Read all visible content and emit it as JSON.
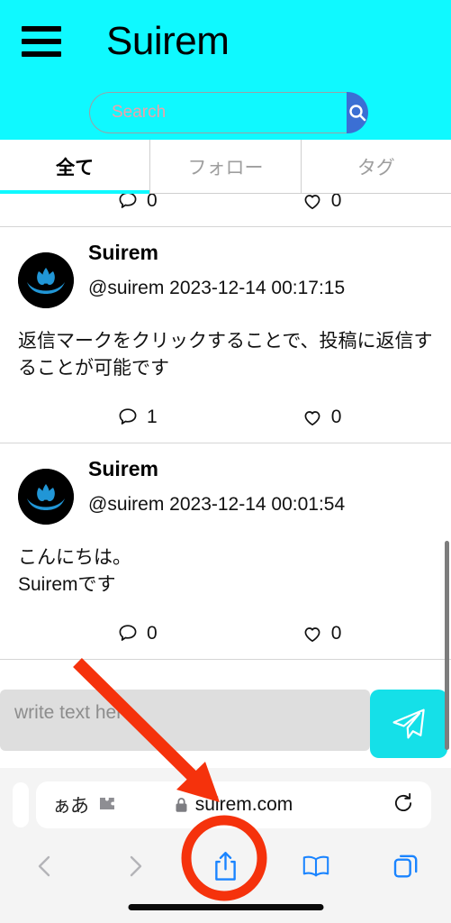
{
  "app": {
    "title": "Suirem",
    "menu_icon": "hamburger-menu-icon",
    "search": {
      "placeholder": "Search",
      "value": "",
      "button_icon": "search-icon",
      "button_color": "#3b6fd4"
    },
    "header_color": "#0ff9ff",
    "tabs": [
      {
        "label": "全て",
        "active": true
      },
      {
        "label": "フォロー",
        "active": false
      },
      {
        "label": "タグ",
        "active": false
      }
    ]
  },
  "feed": {
    "posts": [
      {
        "partial": true,
        "display_name": "",
        "handle": "",
        "timestamp": "",
        "body": "",
        "reply_count": "0",
        "like_count": "0"
      },
      {
        "partial": false,
        "display_name": "Suirem",
        "handle": "@suirem",
        "timestamp": "2023-12-14 00:17:15",
        "body": "返信マークをクリックすることで、投稿に返信することが可能です",
        "reply_count": "1",
        "like_count": "0"
      },
      {
        "partial": false,
        "display_name": "Suirem",
        "handle": "@suirem",
        "timestamp": "2023-12-14 00:01:54",
        "body": "こんにちは。\nSuiremです",
        "reply_count": "0",
        "like_count": "0"
      }
    ],
    "reply_icon": "speech-bubble-icon",
    "like_icon": "heart-icon",
    "avatar_icon": "lotus-flower-avatar"
  },
  "composer": {
    "placeholder": "write text here",
    "value": "",
    "send_icon": "paper-plane-send-icon",
    "send_color": "#15e0e8"
  },
  "browser": {
    "text_size_label": "ぁあ",
    "extensions_icon": "puzzle-piece-icon",
    "lock_icon": "lock-icon",
    "url": "suirem.com",
    "reload_icon": "reload-icon",
    "toolbar": [
      {
        "name": "back-button",
        "icon": "chevron-left-icon",
        "enabled": false
      },
      {
        "name": "forward-button",
        "icon": "chevron-right-icon",
        "enabled": false
      },
      {
        "name": "share-button",
        "icon": "share-up-arrow-icon",
        "enabled": true,
        "highlighted": true
      },
      {
        "name": "bookmarks-button",
        "icon": "open-book-icon",
        "enabled": true
      },
      {
        "name": "tabs-button",
        "icon": "copy-tabs-icon",
        "enabled": true
      }
    ]
  },
  "annotation": {
    "color": "#f5320c",
    "arrow_label": "red-arrow-pointing-to-share-button",
    "circle_label": "red-circle-highlight-share-button"
  }
}
